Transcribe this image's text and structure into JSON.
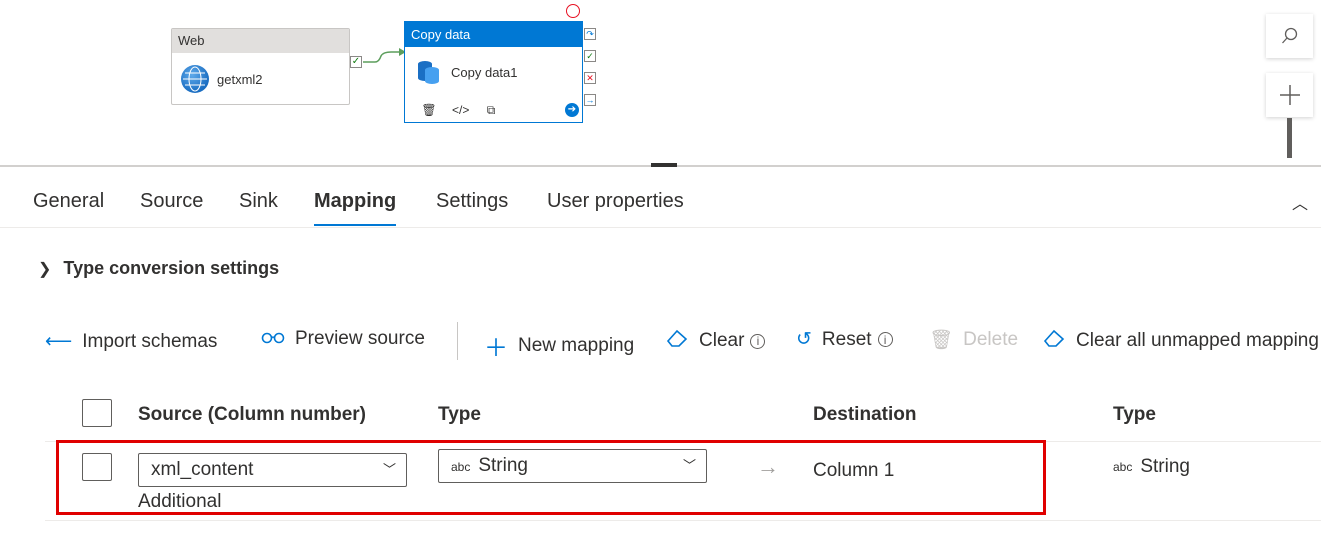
{
  "canvas": {
    "web_activity": {
      "type_label": "Web",
      "name": "getxml2"
    },
    "copy_activity": {
      "type_label": "Copy data",
      "name": "Copy data1"
    },
    "icons": [
      "globe-icon",
      "database-icon",
      "delete-icon",
      "code-icon",
      "copy-icon",
      "run-icon",
      "search-icon",
      "plus-icon"
    ]
  },
  "tabs": [
    "General",
    "Source",
    "Sink",
    "Mapping",
    "Settings",
    "User properties"
  ],
  "active_tab": "Mapping",
  "type_conversion": {
    "label": "Type conversion settings"
  },
  "toolbar": {
    "import_schemas": "Import schemas",
    "preview_source": "Preview source",
    "new_mapping": "New mapping",
    "clear": "Clear",
    "reset": "Reset",
    "delete": "Delete",
    "clear_unmapped": "Clear all unmapped mapping"
  },
  "grid": {
    "headers": {
      "source": "Source (Column number)",
      "type": "Type",
      "destination": "Destination",
      "dest_type": "Type"
    },
    "rows": [
      {
        "source_value": "xml_content",
        "source_type_tag": "abc",
        "source_type": "String",
        "destination": "Column 1",
        "dest_type_tag": "abc",
        "dest_type": "String",
        "note": "Additional"
      }
    ]
  },
  "colors": {
    "accent": "#0078d4",
    "highlight": "#e00000",
    "success": "#107c10",
    "fail": "#e81123"
  }
}
